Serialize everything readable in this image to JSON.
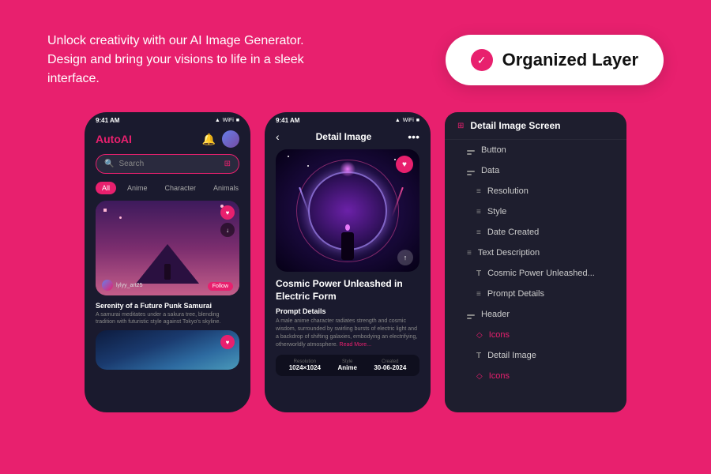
{
  "background": "#e8206e",
  "header": {
    "tagline": "Unlock creativity with our AI Image Generator.\nDesign and bring your visions to life in a sleek interface.",
    "badge": {
      "check_symbol": "✓",
      "label": "Organized Layer"
    }
  },
  "phone1": {
    "status_time": "9:41 AM",
    "logo_prefix": "Auto",
    "logo_suffix": "AI",
    "search_placeholder": "Search",
    "filters": [
      "All",
      "Anime",
      "Character",
      "Animals"
    ],
    "active_filter": "All",
    "card1": {
      "username": "lylyy_art25",
      "title": "Serenity of a Future Punk Samurai",
      "description": "A samurai meditates under a sakura tree, blending tradition with futuristic style against Tokyo's skyline."
    },
    "card2_partial": true
  },
  "phone2": {
    "status_time": "9:41 AM",
    "title": "Detail Image",
    "image_title": "Cosmic Power Unleashed in Electric Form",
    "prompt_label": "Prompt Details",
    "prompt_text": "A male anime character radiates strength and cosmic wisdom, surrounded by swirling bursts of electric light and a backdrop of shifting galaxies, embodying an electrifying, otherworldly atmosphere.",
    "read_more": "Read More...",
    "meta": {
      "resolution_label": "Resolution",
      "resolution_value": "1024×1024",
      "style_label": "Style",
      "style_value": "Anime",
      "created_label": "Created",
      "created_value": "30-06-2024"
    }
  },
  "layer_panel": {
    "root_label": "Detail Image Screen",
    "items": [
      {
        "id": "button",
        "label": "Button",
        "indent": 1,
        "icon": "component"
      },
      {
        "id": "data",
        "label": "Data",
        "indent": 1,
        "icon": "component"
      },
      {
        "id": "resolution",
        "label": "Resolution",
        "indent": 2,
        "icon": "rows"
      },
      {
        "id": "style",
        "label": "Style",
        "indent": 2,
        "icon": "rows"
      },
      {
        "id": "date-created",
        "label": "Date Created",
        "indent": 2,
        "icon": "rows"
      },
      {
        "id": "text-description",
        "label": "Text Description",
        "indent": 1,
        "icon": "rows"
      },
      {
        "id": "cosmic-power",
        "label": "Cosmic Power Unleashed...",
        "indent": 2,
        "icon": "text"
      },
      {
        "id": "prompt-details",
        "label": "Prompt Details",
        "indent": 2,
        "icon": "rows"
      },
      {
        "id": "header",
        "label": "Header",
        "indent": 1,
        "icon": "component"
      },
      {
        "id": "icons1",
        "label": "Icons",
        "indent": 2,
        "icon": "diamond",
        "accent": true
      },
      {
        "id": "detail-image-text",
        "label": "Detail Image",
        "indent": 2,
        "icon": "text"
      },
      {
        "id": "icons2",
        "label": "Icons",
        "indent": 2,
        "icon": "diamond",
        "accent": true
      }
    ]
  }
}
